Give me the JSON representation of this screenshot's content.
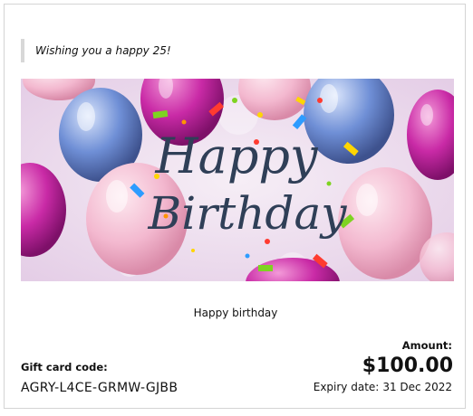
{
  "message": "Wishing you a happy 25!",
  "banner": {
    "heading_line1": "Happy",
    "heading_line2": "Birthday",
    "colors": {
      "background": "#ecdcec",
      "lettering": "#2f3f57",
      "magenta": "#c92aa6",
      "pink": "#f3b8cf",
      "blue": "#6f8fd6"
    }
  },
  "caption": "Happy birthday",
  "gift_card": {
    "code_label": "Gift card code:",
    "code": "AGRY-L4CE-GRMW-GJBB",
    "amount_label": "Amount:",
    "amount": "$100.00",
    "expiry_label": "Expiry date:",
    "expiry_date": "31 Dec 2022"
  }
}
